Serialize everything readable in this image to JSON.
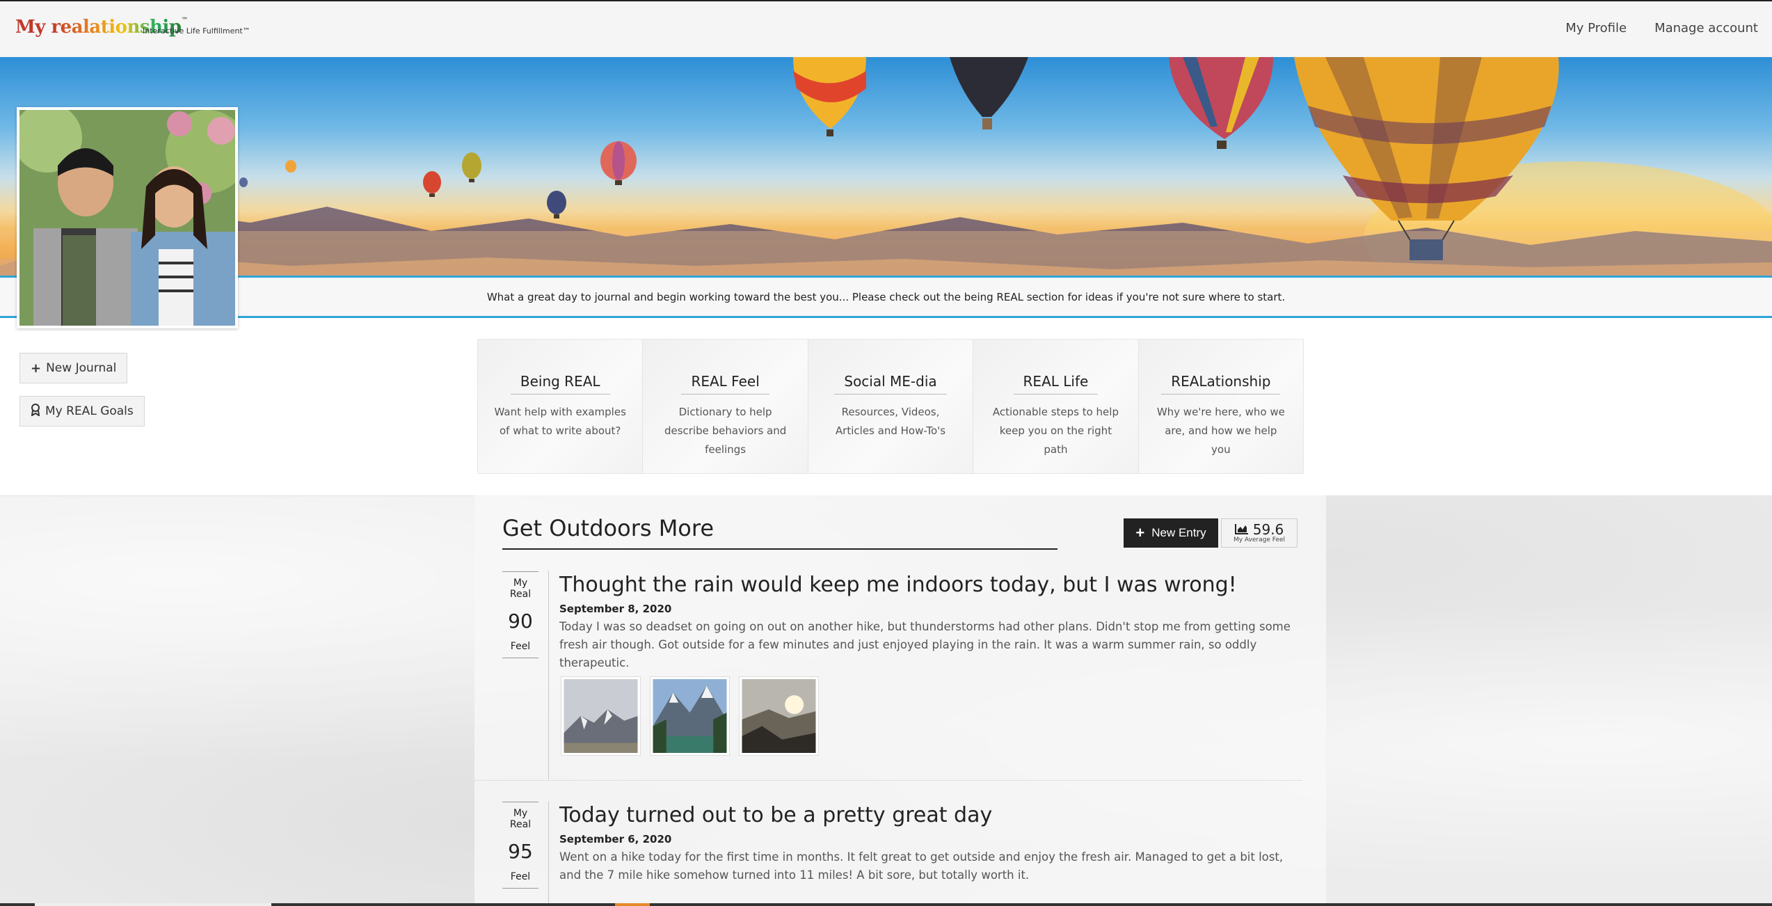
{
  "header": {
    "logo_my": "My ",
    "logo_name": "realationship",
    "logo_tm": "™",
    "tagline": "Interactive Life Fulfillment™",
    "nav": [
      "My Profile",
      "Manage account"
    ]
  },
  "banner": {
    "message": "What a great day to journal and begin working toward the best you... Please check out the being REAL section for ideas if you're not sure where to start."
  },
  "sidebar": {
    "new_journal": "New Journal",
    "goals": "My REAL Goals"
  },
  "categories": [
    {
      "title": "Being REAL",
      "desc": "Want help with examples of what to write about?"
    },
    {
      "title": "REAL Feel",
      "desc": "Dictionary to help describe behaviors and feelings"
    },
    {
      "title": "Social ME-dia",
      "desc": "Resources, Videos, Articles and How-To's"
    },
    {
      "title": "REAL Life",
      "desc": "Actionable steps to help keep you on the right path"
    },
    {
      "title": "REALationship",
      "desc": "Why we're here, who we are, and how we help you"
    }
  ],
  "journal": {
    "title": "Get Outdoors More",
    "new_entry": "New Entry",
    "avg_value": "59.6",
    "avg_label": "My Average Feel",
    "entries": [
      {
        "feel_top": "My Real",
        "feel_value": "90",
        "feel_bottom": "Feel",
        "title": "Thought the rain would keep me indoors today, but I was wrong!",
        "date": "September 8, 2020",
        "text": "Today I was so deadset on going on out on another hike, but thunderstorms had other plans.   Didn't stop me from getting some fresh air though. Got outside for a few minutes and just enjoyed playing in the rain. It was a warm summer rain, so oddly therapeutic."
      },
      {
        "feel_top": "My Real",
        "feel_value": "95",
        "feel_bottom": "Feel",
        "title": "Today turned out to be a pretty great day",
        "date": "September 6, 2020",
        "text": "Went on a hike today for the first time in months. It felt great to get outside and enjoy the fresh air. Managed to get a bit lost, and the 7 mile hike somehow turned into 11 miles! A bit sore, but totally worth it."
      }
    ]
  },
  "colors": {
    "accent_blue": "#2ea4d8",
    "button_dark": "#222222"
  }
}
